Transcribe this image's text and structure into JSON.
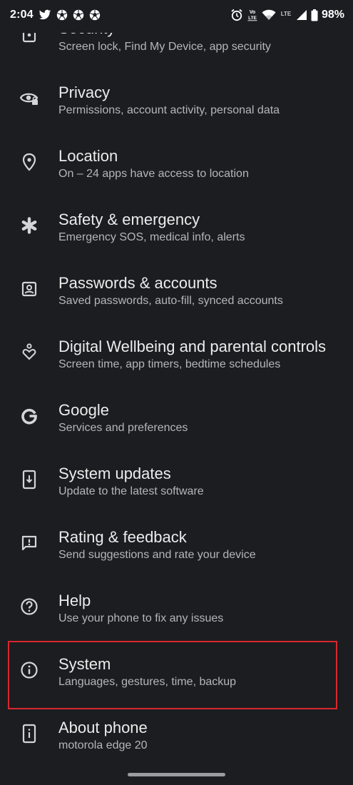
{
  "status_bar": {
    "time": "2:04",
    "battery": "98%",
    "left_icons": [
      "twitter-icon",
      "soccer-ball-icon",
      "soccer-ball-icon",
      "soccer-ball-icon"
    ],
    "right_icons": [
      "alarm-icon",
      "volte-icon",
      "wifi-icon",
      "lte-icon",
      "signal-icon",
      "battery-icon"
    ],
    "volte_label": "Vo LTE",
    "lte_label": "LTE"
  },
  "settings": [
    {
      "id": "security",
      "icon": "security-icon",
      "title": "Security",
      "subtitle": "Screen lock, Find My Device, app security"
    },
    {
      "id": "privacy",
      "icon": "privacy-eye-icon",
      "title": "Privacy",
      "subtitle": "Permissions, account activity, personal data"
    },
    {
      "id": "location",
      "icon": "location-pin-icon",
      "title": "Location",
      "subtitle": "On – 24 apps have access to location"
    },
    {
      "id": "safety",
      "icon": "asterisk-icon",
      "title": "Safety & emergency",
      "subtitle": "Emergency SOS, medical info, alerts"
    },
    {
      "id": "passwords",
      "icon": "account-box-icon",
      "title": "Passwords & accounts",
      "subtitle": "Saved passwords, auto-fill, synced accounts"
    },
    {
      "id": "wellbeing",
      "icon": "heart-person-icon",
      "title": "Digital Wellbeing and parental controls",
      "subtitle": "Screen time, app timers, bedtime schedules"
    },
    {
      "id": "google",
      "icon": "google-g-icon",
      "title": "Google",
      "subtitle": "Services and preferences"
    },
    {
      "id": "system-updates",
      "icon": "system-update-icon",
      "title": "System updates",
      "subtitle": "Update to the latest software"
    },
    {
      "id": "feedback",
      "icon": "feedback-icon",
      "title": "Rating & feedback",
      "subtitle": "Send suggestions and rate your device"
    },
    {
      "id": "help",
      "icon": "help-circle-icon",
      "title": "Help",
      "subtitle": "Use your phone to fix any issues"
    },
    {
      "id": "system",
      "icon": "info-circle-icon",
      "title": "System",
      "subtitle": "Languages, gestures, time, backup"
    },
    {
      "id": "about",
      "icon": "phone-info-icon",
      "title": "About phone",
      "subtitle": "motorola edge 20"
    }
  ],
  "highlighted_item": "system",
  "colors": {
    "background": "#1b1d20",
    "title": "#ececec",
    "subtitle": "#b4b6b9",
    "icon": "#d3d5d8",
    "highlight": "#d9272d"
  }
}
